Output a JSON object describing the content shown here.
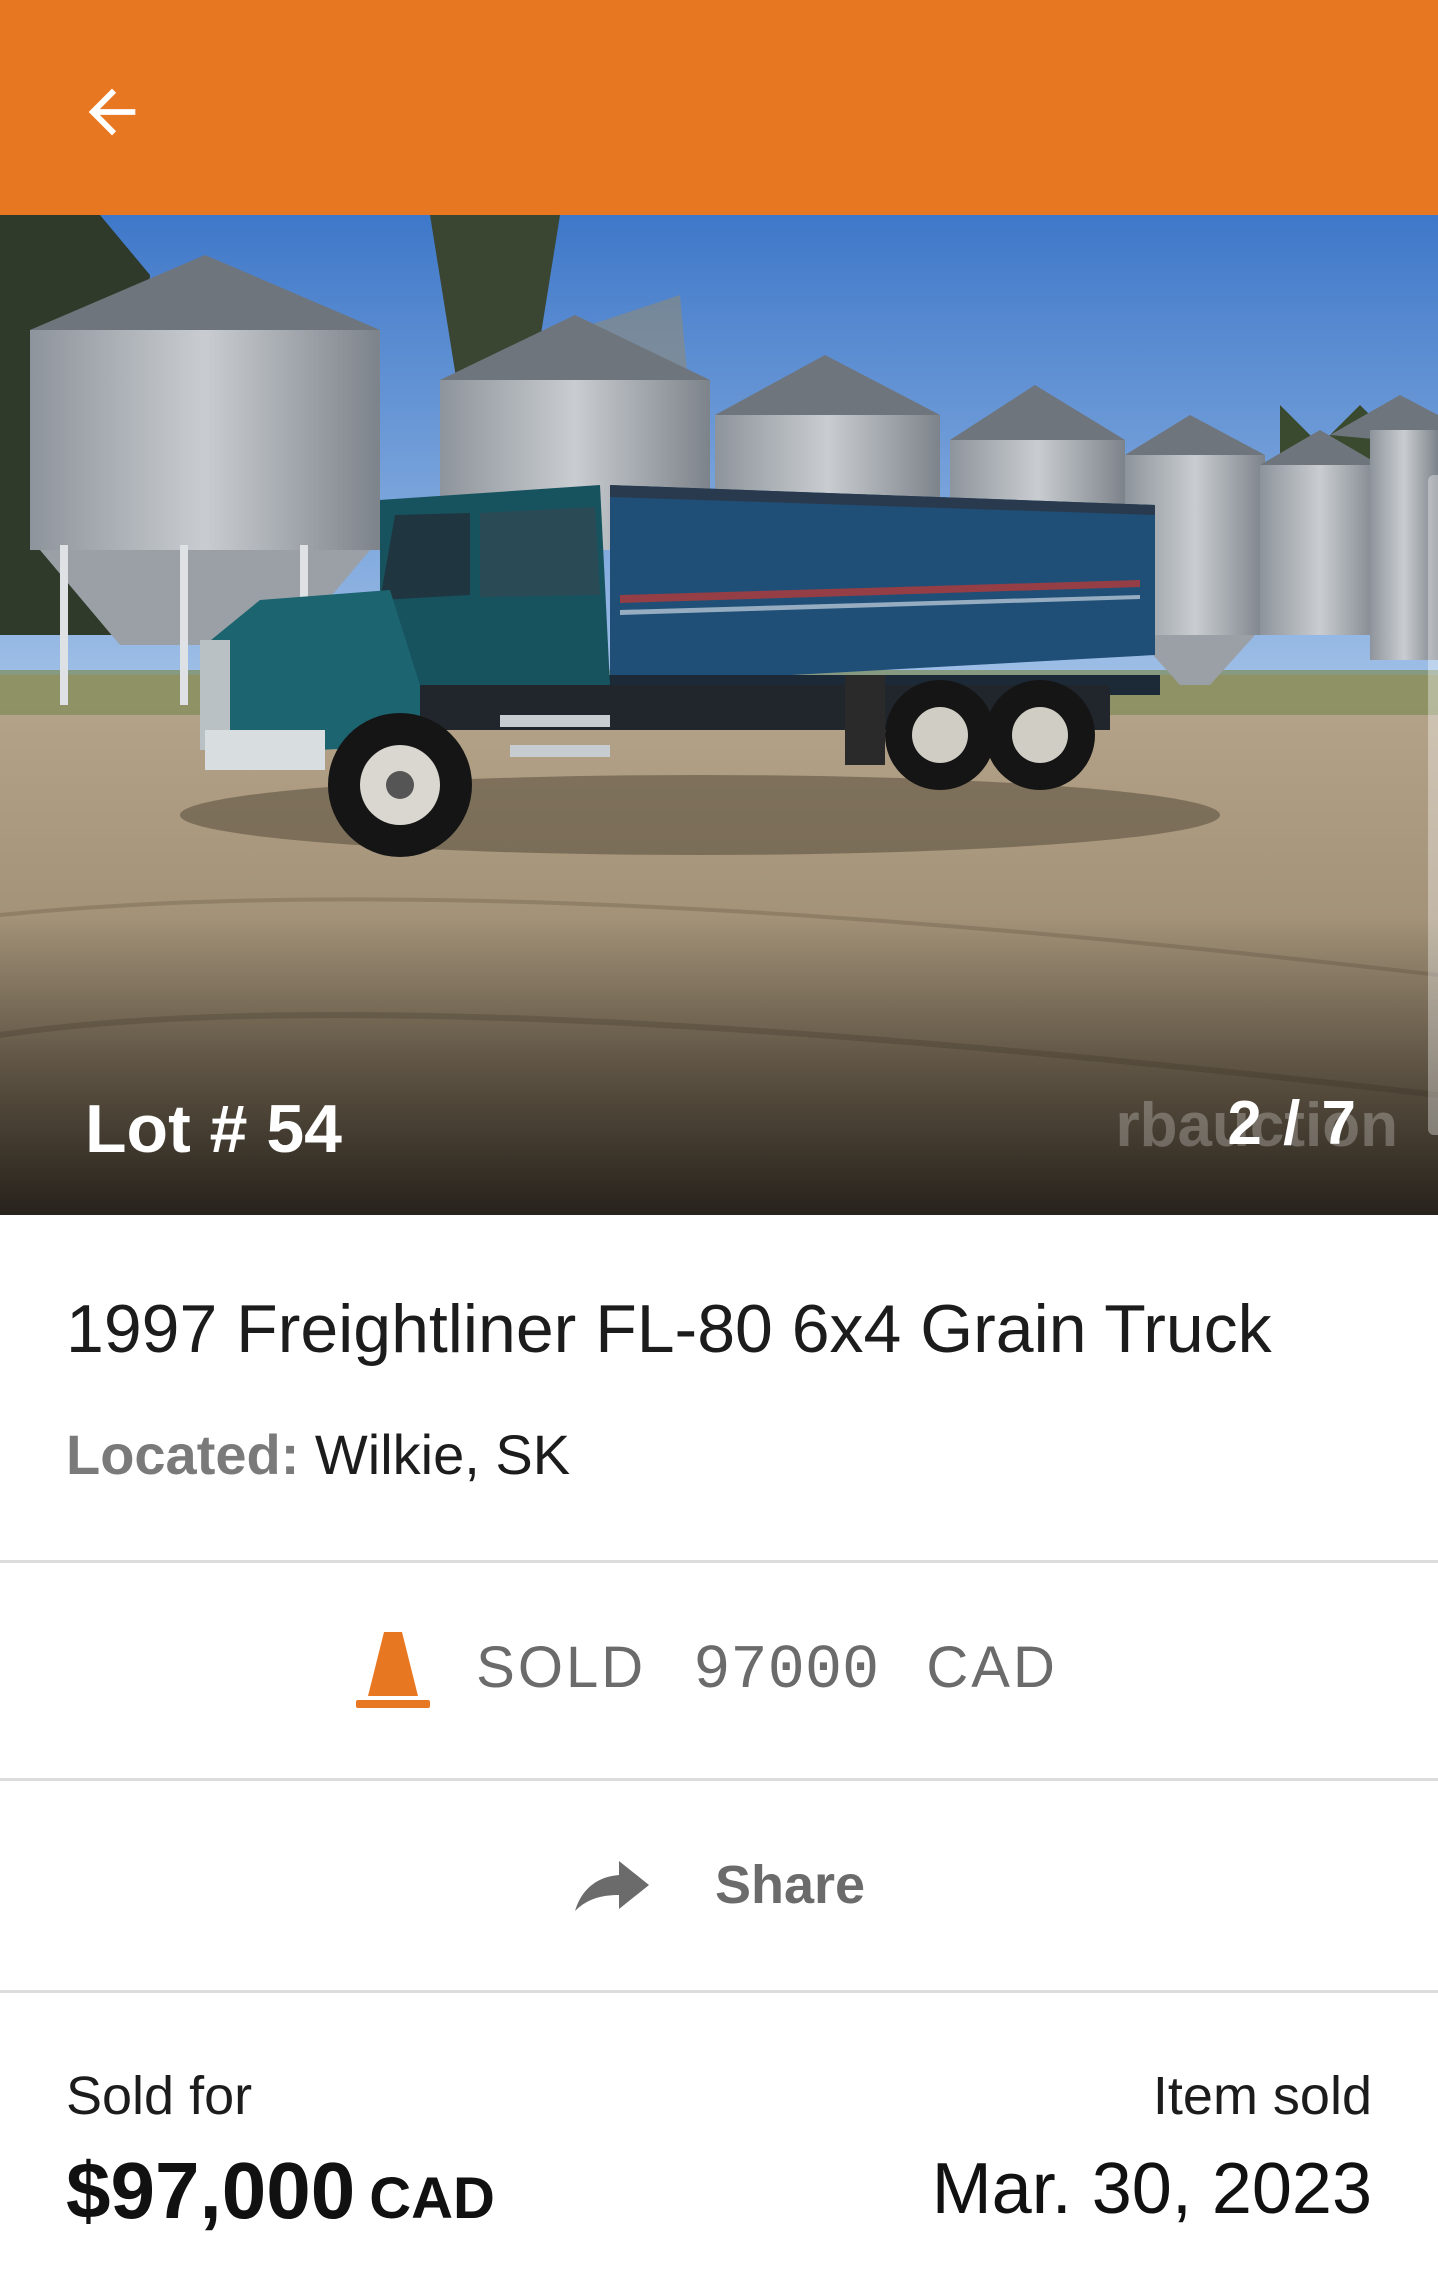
{
  "header": {
    "back_icon": "arrow-left-icon",
    "brand_color": "#E87722"
  },
  "gallery": {
    "lot_label": "Lot # 54",
    "counter": "2 / 7",
    "watermark": "rbauction"
  },
  "listing": {
    "title": "1997 Freightliner FL-80 6x4 Grain Truck",
    "location_label": "Located:",
    "location_value": "Wilkie, SK"
  },
  "status": {
    "icon": "cone-icon",
    "icon_color": "#E87722",
    "sold_word": "SOLD",
    "amount": "97000",
    "currency": "CAD"
  },
  "share": {
    "icon": "share-arrow-icon",
    "label": "Share"
  },
  "sale": {
    "sold_for_label": "Sold for",
    "price": "$97,000",
    "price_currency": "CAD",
    "item_sold_label": "Item sold",
    "date": "Mar. 30, 2023"
  }
}
